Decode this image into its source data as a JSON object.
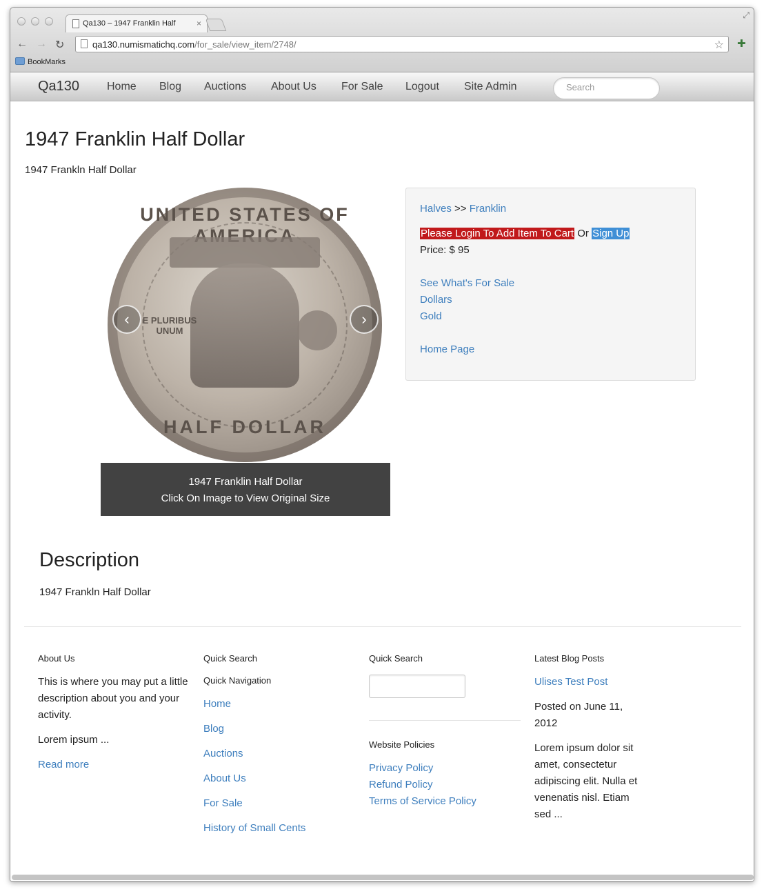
{
  "browser": {
    "tab_title": "Qa130 – 1947 Franklin Half",
    "tab_close": "×",
    "url_host": "qa130.numismatichq.com",
    "url_path": "/for_sale/view_item/2748/",
    "bookmarks_label": "BookMarks"
  },
  "navbar": {
    "brand": "Qa130",
    "items": [
      "Home",
      "Blog",
      "Auctions",
      "About Us",
      "For Sale",
      "Logout",
      "Site Admin"
    ],
    "search_placeholder": "Search"
  },
  "item": {
    "title": "1947 Franklin Half Dollar",
    "subtitle": "1947 Frankln Half Dollar",
    "image": {
      "legend_top": "UNITED STATES OF AMERICA",
      "motto": "E PLURIBUS UNUM",
      "legend_bottom": "HALF DOLLAR",
      "prev_icon": "‹",
      "next_icon": "›"
    },
    "caption_line1": "1947 Franklin Half Dollar",
    "caption_line2": "Click On Image to View Original Size"
  },
  "panel": {
    "crumb_1": "Halves",
    "crumb_sep": ">>",
    "crumb_2": "Franklin",
    "login_label": "Please Login To Add Item To Cart",
    "or_text": "Or",
    "signup_label": "Sign Up",
    "price": "Price: $ 95",
    "links": [
      "See What's For Sale",
      "Dollars",
      "Gold"
    ],
    "home_link": "Home Page"
  },
  "description": {
    "heading": "Description",
    "text": "1947 Frankln Half Dollar"
  },
  "footer": {
    "about": {
      "heading": "About Us",
      "text": "This is where you may put a little description about you and your activity.",
      "lorem": "Lorem ipsum ...",
      "read_more": "Read more"
    },
    "nav": {
      "heading": "Quick Search",
      "subheading": "Quick Navigation",
      "links": [
        "Home",
        "Blog",
        "Auctions",
        "About Us",
        "For Sale",
        "History of Small Cents"
      ]
    },
    "search": {
      "heading": "Quick Search",
      "policies_heading": "Website Policies",
      "policies": [
        "Privacy Policy",
        "Refund Policy",
        "Terms of Service Policy"
      ]
    },
    "blog": {
      "heading": "Latest Blog Posts",
      "post_title": "Ulises Test Post",
      "posted": "Posted on June 11, 2012",
      "excerpt": "Lorem ipsum dolor sit amet, consectetur adipiscing elit. Nulla et venenatis nisl. Etiam sed ..."
    }
  },
  "colors": {
    "link": "#3d7ebd",
    "login_button": "#c1191b",
    "signup_button": "#3f8fd6",
    "caption_bg": "#424242"
  },
  "icons": {
    "back": "←",
    "forward": "→",
    "reload": "↻",
    "star": "☆",
    "resize": "⤢",
    "extension": "✚"
  }
}
